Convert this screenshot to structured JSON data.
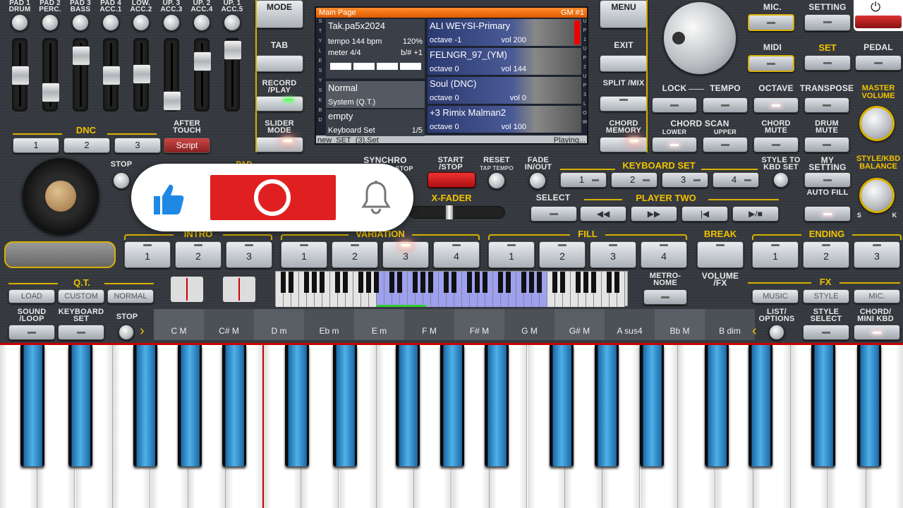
{
  "pads": {
    "labels": [
      "PAD 1 DRUM",
      "PAD 2 PERC.",
      "PAD 3 BASS",
      "PAD 4 ACC.1",
      "LOW. ACC.2",
      "UP. 3 ACC.3",
      "UP. 2 ACC.4",
      "UP. 1 ACC.5"
    ]
  },
  "left_buttons": {
    "mode": "MODE",
    "tab": "TAB",
    "record": "RECORD /PLAY",
    "slider_mode": "SLIDER MODE"
  },
  "dnc": {
    "title": "DNC",
    "after_touch": "AFTER TOUCH",
    "buttons": [
      "1",
      "2",
      "3"
    ],
    "script": "Script"
  },
  "stop_label": "STOP",
  "pad_label": "PAD",
  "display": {
    "header": "Main Page",
    "header_right": "GM #1",
    "style_name": "Tak.pa5x2024",
    "tempo": "tempo 144 bpm",
    "percent": "120%",
    "meter": "meter 4/4",
    "bshift": "b/# +1",
    "left_rows": [
      {
        "title": "Normal",
        "sub": "System (Q.T.)",
        "right": ""
      },
      {
        "title": "empty",
        "sub": "Keyboard Set",
        "right": "1/5"
      }
    ],
    "side_left": [
      "S",
      "T",
      "Y",
      "L",
      "E",
      "S",
      "Y",
      "S",
      "K",
      "B",
      "D"
    ],
    "side_right": [
      "U",
      "P",
      "1",
      "U",
      "P",
      "2",
      "U",
      "P",
      "3",
      "L",
      "O",
      "W"
    ],
    "voices": [
      {
        "name": "ALI WEYSI-Primary",
        "octave": "octave -1",
        "vol": "vol 200"
      },
      {
        "name": "FELNGR_97_(YM)",
        "octave": "octave  0",
        "vol": "vol 144"
      },
      {
        "name": "Soul (DNC)",
        "octave": "octave  0",
        "vol": "vol 0"
      },
      {
        "name": "+3 Rimix Malman2",
        "octave": "octave  0",
        "vol": "vol 100"
      }
    ],
    "footer_left": "new_SET_(3).Set",
    "footer_right": "Playing..."
  },
  "right_top": {
    "menu": "MENU",
    "exit": "EXIT",
    "split_mix": "SPLIT /MIX",
    "chord_memory": "CHORD MEMORY",
    "mic": "MIC.",
    "setting": "SETTING",
    "midi": "MIDI",
    "set": "SET",
    "pedal": "PEDAL"
  },
  "row2": {
    "lock": "LOCK",
    "tempo": "TEMPO",
    "octave": "OCTAVE",
    "transpose": "TRANSPOSE",
    "master_volume": "MASTER VOLUME",
    "chord_scan": "CHORD SCAN",
    "lower": "LOWER",
    "upper": "UPPER",
    "chord_mute": "CHORD MUTE",
    "drum_mute": "DRUM MUTE",
    "style_to_kbd": "STYLE TO KBD SET",
    "my_setting": "MY SETTING",
    "style_kbd_balance": "STYLE/KBD BALANCE",
    "auto_fill": "AUTO FILL",
    "s": "S",
    "k": "K"
  },
  "mid": {
    "synchro": "SYNCHRO",
    "start": "START",
    "stop": "STOP",
    "start_stop": "START /STOP",
    "reset": "RESET",
    "tap_tempo": "TAP TEMPO",
    "fade": "FADE IN/OUT",
    "xfader": "X-FADER",
    "keyboard_set": "KEYBOARD SET",
    "kbd_buttons": [
      "1",
      "2",
      "3",
      "4"
    ],
    "select": "SELECT",
    "player_two": "PLAYER TWO",
    "player_symbols": [
      "◀◀",
      "▶▶",
      "|◀",
      "▶/■"
    ]
  },
  "sections": {
    "intro": "INTRO",
    "variation": "VARIATION",
    "fill": "FILL",
    "break": "BREAK",
    "ending": "ENDING",
    "intro_btns": [
      "1",
      "2",
      "3"
    ],
    "var_btns": [
      "1",
      "2",
      "3",
      "4"
    ],
    "fill_btns": [
      "1",
      "2",
      "3",
      "4"
    ],
    "end_btns": [
      "1",
      "2",
      "3"
    ]
  },
  "qt": {
    "title": "Q.T.",
    "load": "LOAD",
    "custom": "CUSTOM",
    "normal": "NORMAL"
  },
  "lower_row": {
    "sound_loop": "SOUND /LOOP",
    "keyboard_set": "KEYBOARD SET",
    "stop": "STOP",
    "metronome": "METRO- NOME",
    "volume_fx": "VOLUME /FX",
    "fx": "FX",
    "music": "MUSIC",
    "style": "STYLE",
    "mic": "MIC.",
    "list_options": "LIST/ OPTIONS",
    "style_select": "STYLE SELECT",
    "chord_mini": "CHORD/ MINI KBD"
  },
  "chords": [
    "C M",
    "C# M",
    "D m",
    "Eb m",
    "E m",
    "F M",
    "F# M",
    "G M",
    "G# M",
    "A sus4",
    "Bb M",
    "B dim"
  ],
  "colors": {
    "accent_yellow": "#f2c200",
    "display_orange": "#f26a00",
    "youtube_red": "#e02020",
    "like_blue": "#1e88e5",
    "key_blue": "#3a9ad8"
  }
}
